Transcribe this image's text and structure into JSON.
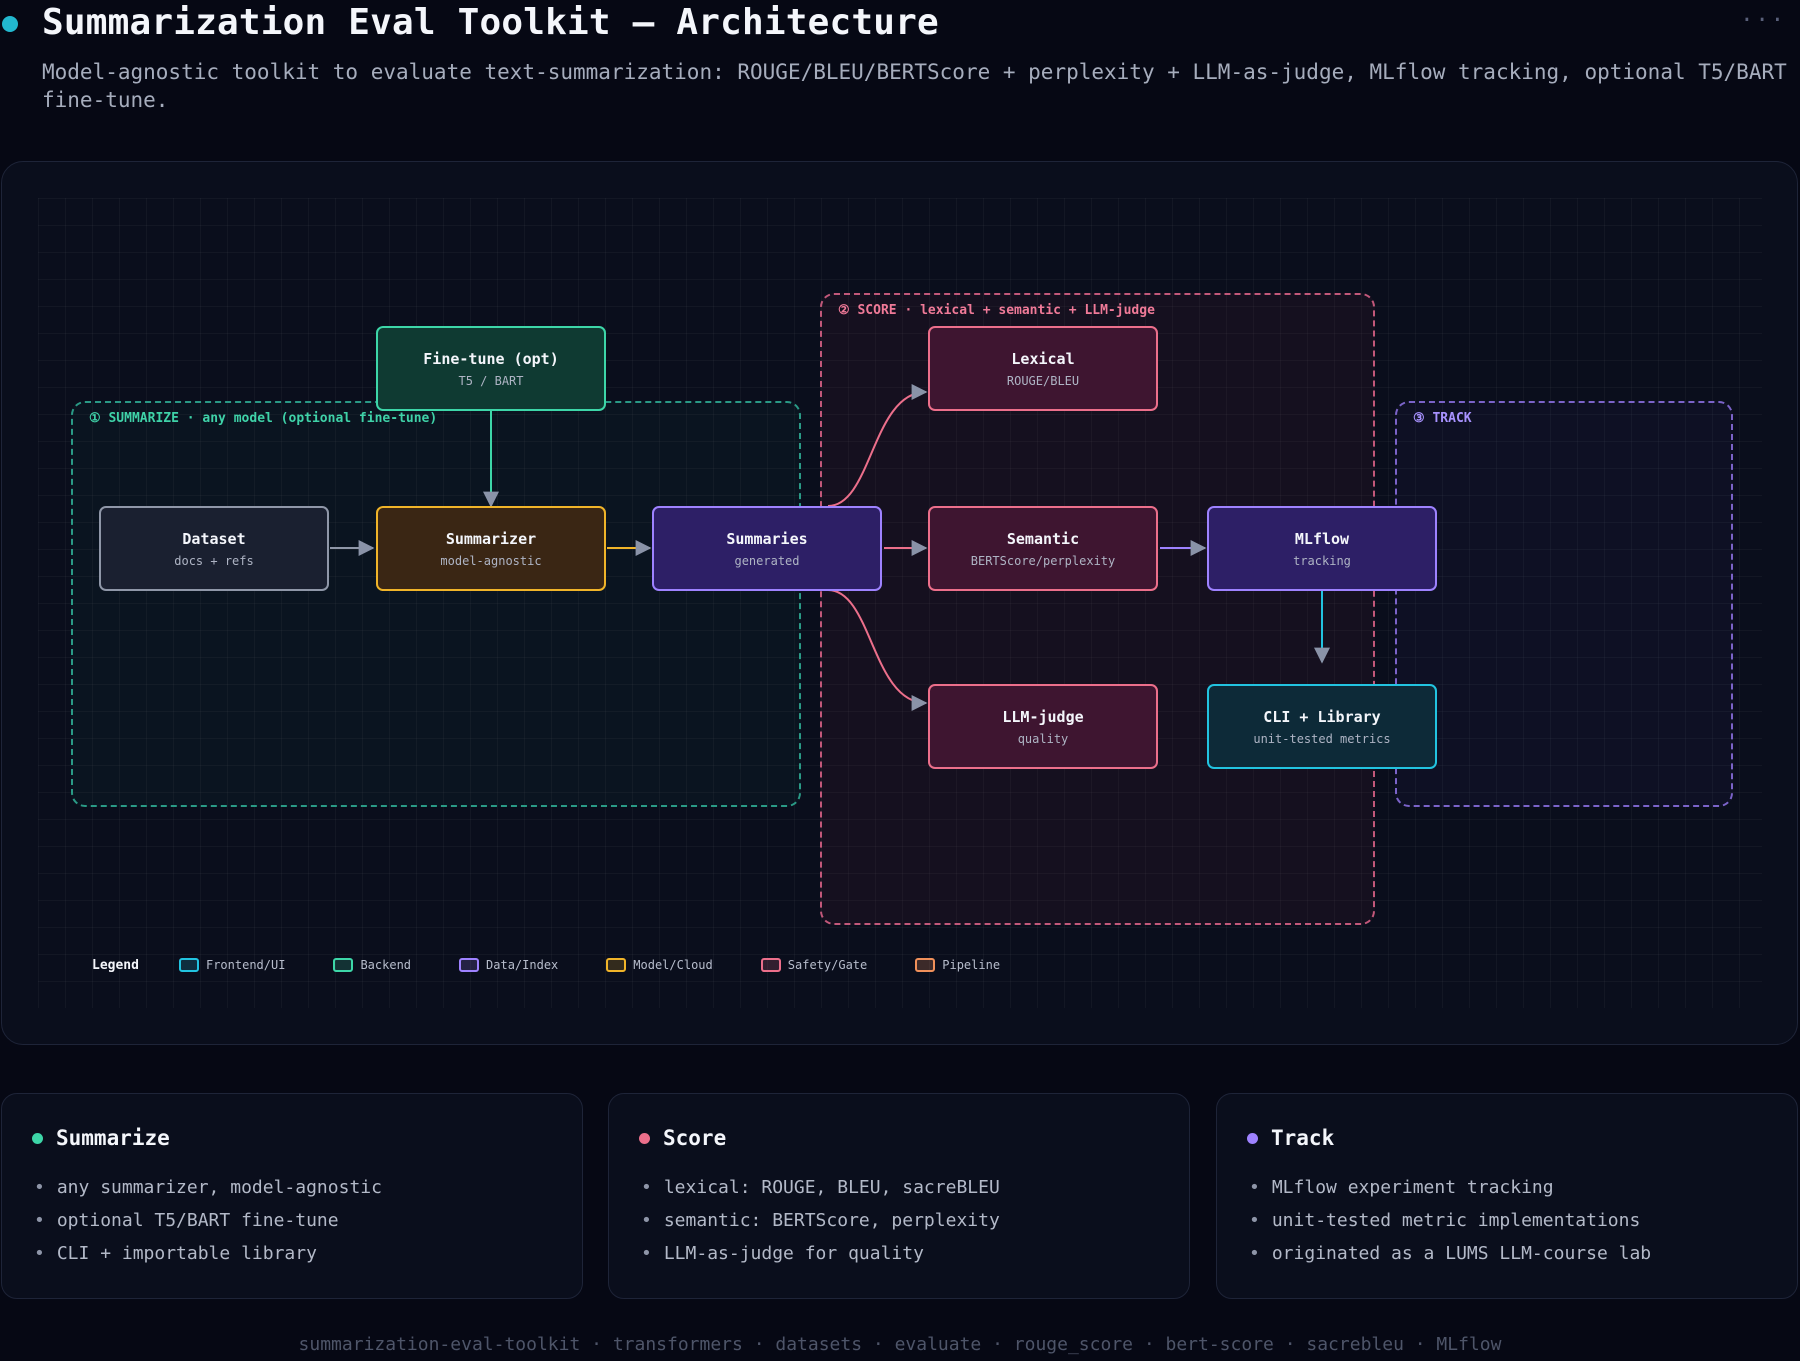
{
  "header": {
    "title": "Summarization Eval Toolkit — Architecture",
    "subtitle": "Model-agnostic toolkit to evaluate text-summarization: ROUGE/BLEU/BERTScore + perplexity + LLM-as-judge, MLflow tracking, optional T5/BART fine-tune.",
    "more": "···"
  },
  "groups": {
    "summarize": "① SUMMARIZE · any model (optional fine-tune)",
    "score": "② SCORE · lexical + semantic + LLM-judge",
    "track": "③ TRACK"
  },
  "nodes": {
    "finetune": {
      "title": "Fine-tune (opt)",
      "sub": "T5 / BART"
    },
    "dataset": {
      "title": "Dataset",
      "sub": "docs + refs"
    },
    "summarizer": {
      "title": "Summarizer",
      "sub": "model-agnostic"
    },
    "summaries": {
      "title": "Summaries",
      "sub": "generated"
    },
    "lexical": {
      "title": "Lexical",
      "sub": "ROUGE/BLEU"
    },
    "semantic": {
      "title": "Semantic",
      "sub": "BERTScore/perplexity"
    },
    "judge": {
      "title": "LLM-judge",
      "sub": "quality"
    },
    "mlflow": {
      "title": "MLflow",
      "sub": "tracking"
    },
    "cli": {
      "title": "CLI + Library",
      "sub": "unit-tested metrics"
    }
  },
  "legend": {
    "title": "Legend",
    "items": [
      {
        "label": "Frontend/UI",
        "color": "#22c3e0"
      },
      {
        "label": "Backend",
        "color": "#3dd6a8"
      },
      {
        "label": "Data/Index",
        "color": "#9e82ff"
      },
      {
        "label": "Model/Cloud",
        "color": "#f0b429"
      },
      {
        "label": "Safety/Gate",
        "color": "#ec6f8b"
      },
      {
        "label": "Pipeline",
        "color": "#f0905a"
      }
    ]
  },
  "cards": [
    {
      "title": "Summarize",
      "color": "#3dd6a8",
      "items": [
        "any summarizer, model-agnostic",
        "optional T5/BART fine-tune",
        "CLI + importable library"
      ]
    },
    {
      "title": "Score",
      "color": "#ec6f8b",
      "items": [
        "lexical: ROUGE, BLEU, sacreBLEU",
        "semantic: BERTScore, perplexity",
        "LLM-as-judge for quality"
      ]
    },
    {
      "title": "Track",
      "color": "#9e82ff",
      "items": [
        "MLflow experiment tracking",
        "unit-tested metric implementations",
        "originated as a LUMS LLM-course lab"
      ]
    }
  ],
  "footer": "summarization-eval-toolkit · transformers · datasets · evaluate · rouge_score · bert-score · sacrebleu · MLflow"
}
